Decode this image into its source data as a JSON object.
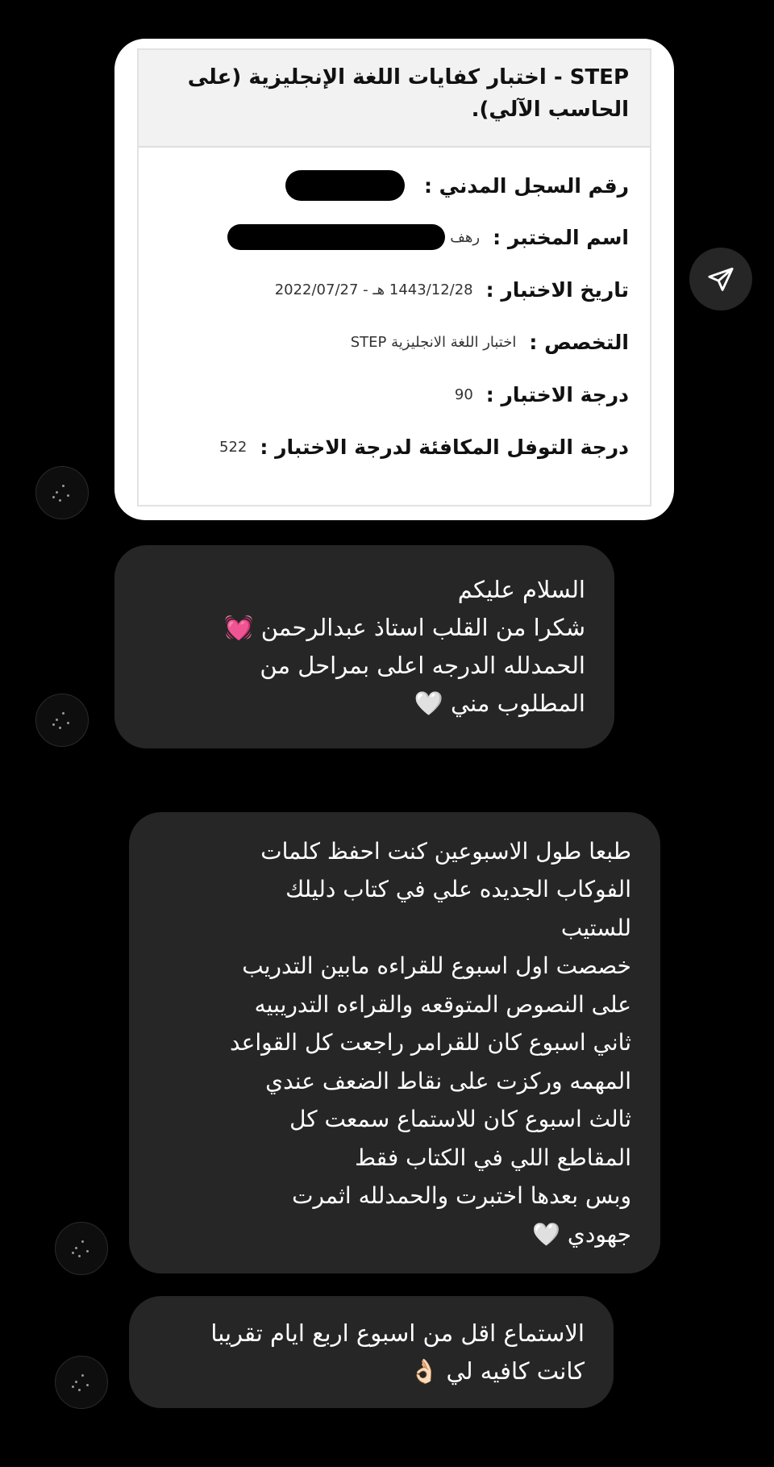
{
  "card": {
    "title": "STEP - اختبار كفايات اللغة الإنجليزية (على الحاسب الآلي).",
    "rows": [
      {
        "label": "رقم السجل المدني :",
        "value": ""
      },
      {
        "label": "اسم المختبر :",
        "value": "رهف"
      },
      {
        "label": "تاريخ الاختبار :",
        "value": "1443/12/28 هـ - 2022/07/27"
      },
      {
        "label": "التخصص :",
        "value": "اختبار اللغة الانجليزية STEP"
      },
      {
        "label": "درجة الاختبار :",
        "value": "90"
      },
      {
        "label": "درجة التوفل المكافئة لدرجة الاختبار :",
        "value": "522"
      }
    ]
  },
  "share_icon": "paper-plane-icon",
  "messages": [
    {
      "text": "السلام عليكم\nشكرا من القلب استاذ عبدالرحمن 💓\nالحمدلله الدرجه اعلى بمراحل من\nالمطلوب مني 🤍"
    },
    {
      "text": "طبعا طول الاسبوعين كنت احفظ كلمات\nالفوكاب الجديده علي في كتاب دليلك\nللستيب\nخصصت اول اسبوع للقراءه مابين التدريب\nعلى النصوص المتوقعه والقراءه التدريبيه\nثاني اسبوع كان للقرامر راجعت كل القواعد\nالمهمه وركزت على نقاط الضعف عندي\nثالث اسبوع كان للاستماع سمعت كل\nالمقاطع اللي في الكتاب فقط\nوبس بعدها اختبرت والحمدلله اثمرت\nجهودي 🤍"
    },
    {
      "text": "الاستماع اقل من اسبوع اربع ايام تقريبا\nكانت كافيه لي 👌🏻"
    }
  ]
}
